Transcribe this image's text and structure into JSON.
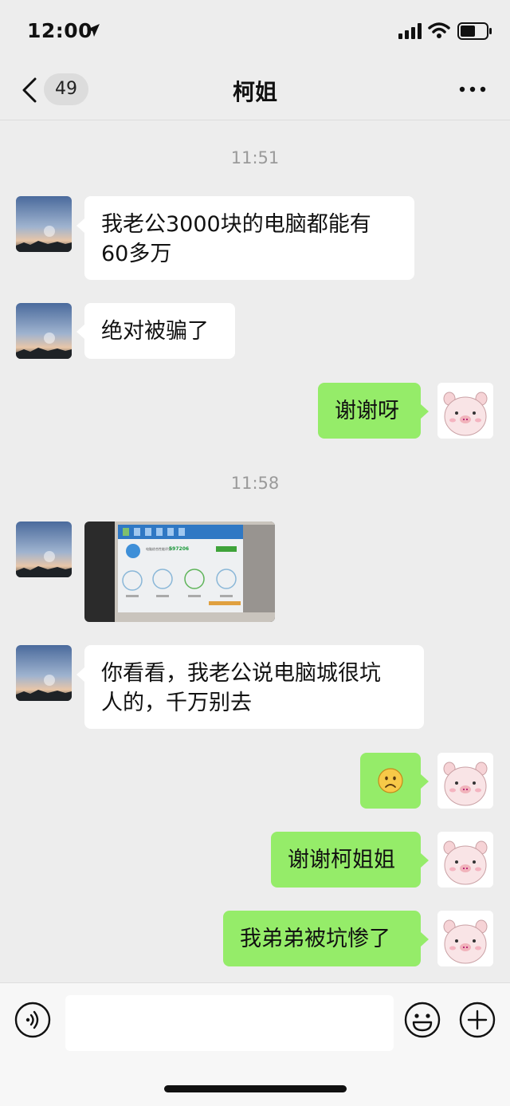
{
  "status_bar": {
    "time": "12:00"
  },
  "header": {
    "unread_count": "49",
    "title": "柯姐"
  },
  "messages": [
    {
      "type": "timestamp",
      "text": "11:51"
    },
    {
      "type": "text",
      "side": "left",
      "text_line1": "我老公3000块的电脑都能有",
      "text_line2": "60多万"
    },
    {
      "type": "text",
      "side": "left",
      "text": "绝对被骗了"
    },
    {
      "type": "text",
      "side": "right",
      "text": "谢谢呀"
    },
    {
      "type": "timestamp",
      "text": "11:58"
    },
    {
      "type": "image",
      "side": "left",
      "embedded_score": "597206"
    },
    {
      "type": "text",
      "side": "left",
      "text_line1": "你看看，我老公说电脑城很坑",
      "text_line2": "人的，千万别去"
    },
    {
      "type": "emoji",
      "side": "right",
      "emoji": "☹"
    },
    {
      "type": "text",
      "side": "right",
      "text": "谢谢柯姐姐"
    },
    {
      "type": "text",
      "side": "right",
      "text": "我弟弟被坑惨了"
    }
  ],
  "colors": {
    "background": "#ededed",
    "outgoing_bubble": "#95ec69",
    "incoming_bubble": "#ffffff"
  }
}
